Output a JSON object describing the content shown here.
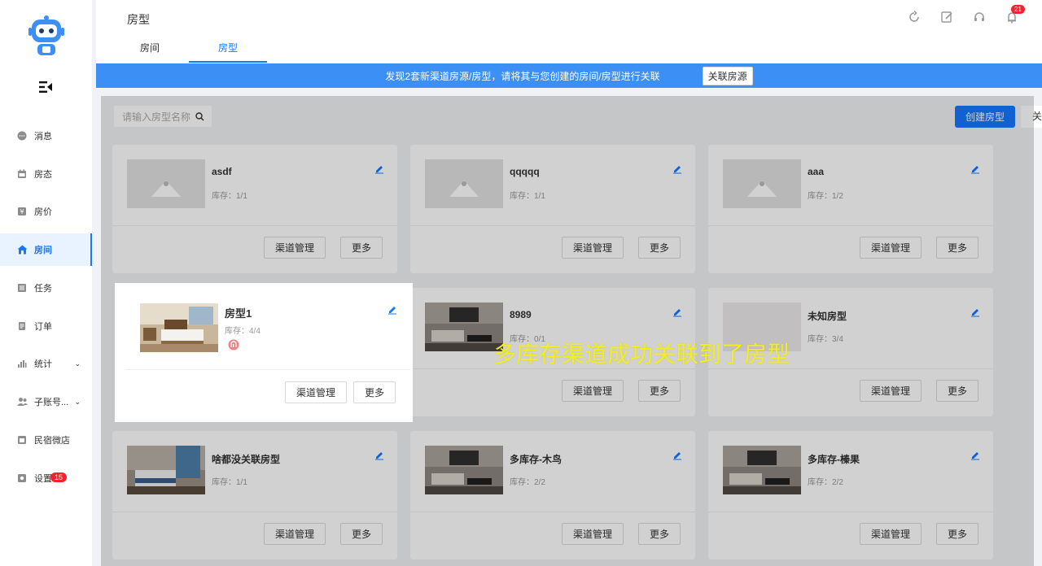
{
  "sidebar": {
    "items": [
      {
        "label": "消息",
        "icon": "message-icon"
      },
      {
        "label": "房态",
        "icon": "calendar-icon"
      },
      {
        "label": "房价",
        "icon": "price-icon"
      },
      {
        "label": "房间",
        "icon": "house-icon",
        "active": true
      },
      {
        "label": "任务",
        "icon": "task-icon"
      },
      {
        "label": "订单",
        "icon": "order-icon"
      },
      {
        "label": "统计",
        "icon": "chart-icon"
      },
      {
        "label": "子账号...",
        "icon": "users-icon"
      },
      {
        "label": "民宿微店",
        "icon": "shop-icon"
      },
      {
        "label": "设置",
        "icon": "settings-icon",
        "badge": "15"
      }
    ]
  },
  "header": {
    "title": "房型",
    "bell_badge": "21",
    "tabs": [
      {
        "label": "房间"
      },
      {
        "label": "房型",
        "active": true
      }
    ]
  },
  "banner": {
    "text": "发现2套新渠道房源/房型，请将其与您创建的房间/房型进行关联",
    "button": "关联房源"
  },
  "toolbar": {
    "search_placeholder": "请输入房型名称",
    "create_button": "创建房型",
    "extra_button": "关"
  },
  "cards": [
    {
      "name": "asdf",
      "stock": "库存：1/1",
      "image": "placeholder"
    },
    {
      "name": "qqqqq",
      "stock": "库存：1/1",
      "image": "placeholder"
    },
    {
      "name": "aaa",
      "stock": "库存：1/2",
      "image": "placeholder"
    },
    {
      "name": "房型1",
      "stock": "库存：4/4",
      "image": "bedroom"
    },
    {
      "name": "8989",
      "stock": "库存：0/1",
      "image": "living"
    },
    {
      "name": "未知房型",
      "stock": "库存：3/4",
      "image": "blank"
    },
    {
      "name": "啥都没关联房型",
      "stock": "库存：1/1",
      "image": "bedroom2"
    },
    {
      "name": "多库存-木鸟",
      "stock": "库存：2/2",
      "image": "living"
    },
    {
      "name": "多库存-榛果",
      "stock": "库存：2/2",
      "image": "living"
    }
  ],
  "card_buttons": {
    "channel": "渠道管理",
    "more": "更多"
  },
  "caption": "多库存渠道成功关联到了房型",
  "colors": {
    "accent": "#1677ff",
    "banner": "#3b8ff5",
    "caption": "#f4ee1e",
    "badge": "#f5222d"
  }
}
